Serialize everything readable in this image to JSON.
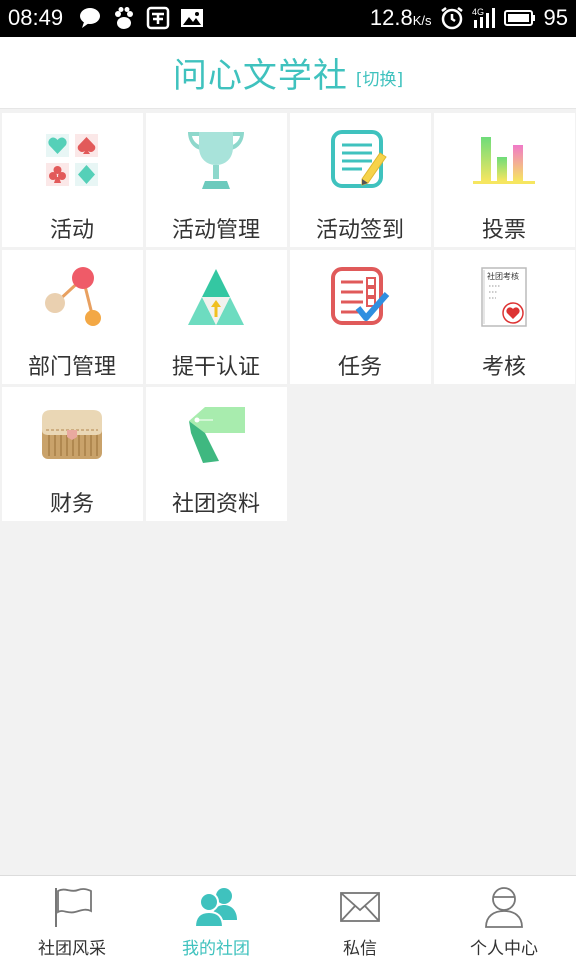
{
  "status_bar": {
    "time": "08:49",
    "speed": "12.8",
    "speed_unit": "K/s",
    "battery": "95",
    "icons": [
      "chat-bubble-icon",
      "paw-icon",
      "pay-icon",
      "image-icon",
      "alarm-icon",
      "signal-4g-icon",
      "battery-icon"
    ]
  },
  "header": {
    "title": "问心文学社",
    "switch_label": "[切换]"
  },
  "grid": {
    "items": [
      {
        "label": "活动",
        "icon": "cards-suits-icon"
      },
      {
        "label": "活动管理",
        "icon": "trophy-icon"
      },
      {
        "label": "活动签到",
        "icon": "notepad-pencil-icon"
      },
      {
        "label": "投票",
        "icon": "bar-chart-icon"
      },
      {
        "label": "部门管理",
        "icon": "org-nodes-icon"
      },
      {
        "label": "提干认证",
        "icon": "triangle-arrow-icon"
      },
      {
        "label": "任务",
        "icon": "checklist-icon"
      },
      {
        "label": "考核",
        "icon": "assessment-paper-icon"
      },
      {
        "label": "财务",
        "icon": "wallet-icon"
      },
      {
        "label": "社团资料",
        "icon": "tag-icon"
      }
    ]
  },
  "colors": {
    "accent": "#3fc2be",
    "background": "#f2f2f2"
  },
  "assessment_icon_text": "社团考核",
  "tabs": [
    {
      "label": "社团风采",
      "icon": "flag-icon",
      "active": false
    },
    {
      "label": "我的社团",
      "icon": "people-icon",
      "active": true
    },
    {
      "label": "私信",
      "icon": "envelope-icon",
      "active": false
    },
    {
      "label": "个人中心",
      "icon": "person-icon",
      "active": false
    }
  ]
}
